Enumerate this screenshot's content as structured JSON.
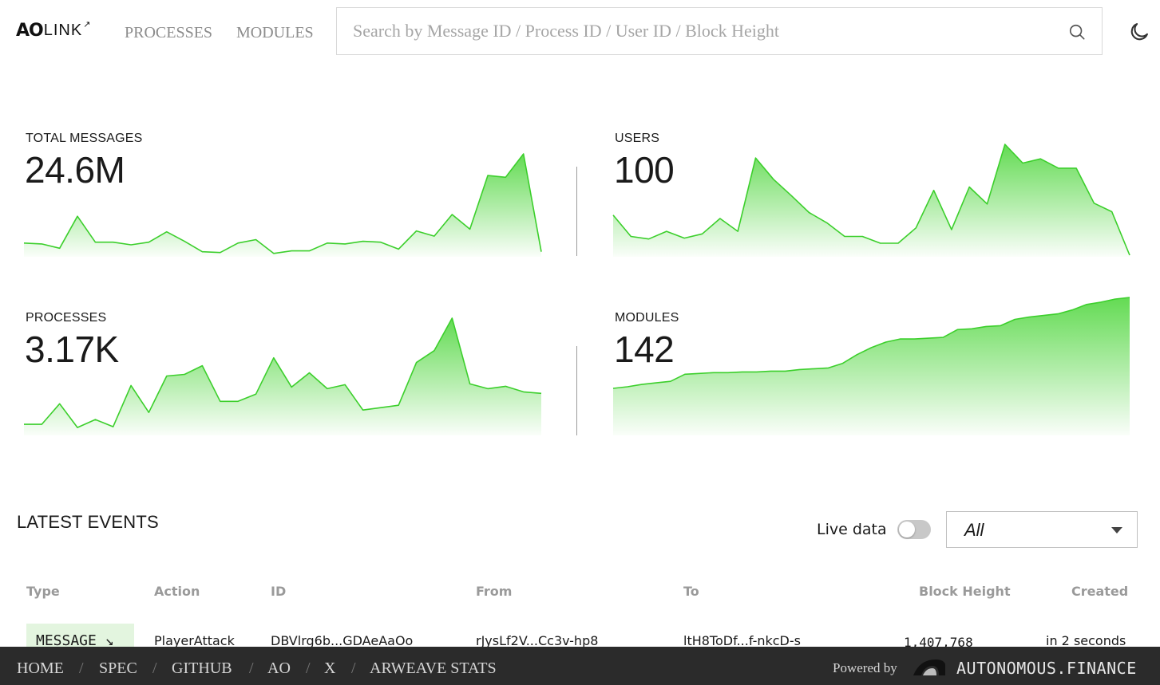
{
  "header": {
    "logo_ao": "AO",
    "logo_link": "LINK",
    "logo_arrow": "↗",
    "nav": [
      {
        "label": "PROCESSES"
      },
      {
        "label": "MODULES"
      }
    ],
    "search_placeholder": "Search by Message ID / Process ID / User ID / Block Height"
  },
  "stats": {
    "total_messages": {
      "label": "TOTAL MESSAGES",
      "value": "24.6M"
    },
    "users": {
      "label": "USERS",
      "value": "100"
    },
    "processes": {
      "label": "PROCESSES",
      "value": "3.17K"
    },
    "modules": {
      "label": "MODULES",
      "value": "142"
    }
  },
  "colors": {
    "accent": "#3ccf2c",
    "fill_top": "#5bd94a"
  },
  "chart_data": [
    {
      "type": "area",
      "name": "total_messages",
      "values": [
        14,
        13,
        8,
        45,
        15,
        15,
        12,
        15,
        27,
        16,
        4,
        3,
        14,
        18,
        2,
        5,
        5,
        14,
        13,
        16,
        15,
        7,
        28,
        22,
        47,
        30,
        92,
        90,
        117,
        4
      ]
    },
    {
      "type": "area",
      "name": "users",
      "values": [
        47,
        22,
        19,
        28,
        20,
        25,
        43,
        28,
        114,
        89,
        70,
        50,
        38,
        22,
        22,
        14,
        14,
        32,
        76,
        30,
        80,
        60,
        130,
        108,
        113,
        102,
        102,
        61,
        51,
        0
      ]
    },
    {
      "type": "area",
      "name": "processes",
      "values": [
        12,
        12,
        38,
        8,
        18,
        9,
        61,
        27,
        73,
        75,
        86,
        41,
        41,
        50,
        96,
        59,
        77,
        57,
        62,
        30,
        33,
        36,
        90,
        105,
        146,
        63,
        57,
        60,
        53,
        51
      ]
    },
    {
      "type": "area",
      "name": "modules",
      "values": [
        58,
        60,
        63,
        65,
        67,
        76,
        77,
        78,
        78,
        79,
        79,
        80,
        80,
        82,
        83,
        84,
        90,
        101,
        110,
        117,
        121,
        121,
        122,
        123,
        133,
        134,
        137,
        138,
        146,
        149,
        151,
        153,
        158,
        165,
        168,
        172,
        174
      ]
    }
  ],
  "events": {
    "title": "LATEST EVENTS",
    "live_label": "Live data",
    "filter_value": "All",
    "columns": [
      "Type",
      "Action",
      "ID",
      "From",
      "To",
      "Block Height",
      "Created"
    ],
    "rows": [
      {
        "type": "MESSAGE ↘",
        "action": "PlayerAttack",
        "id": "DBVlrg6b...GDAeAaOo",
        "from": "rJysLf2V...Cc3v-hp8",
        "to": "ltH8ToDf...f-nkcD-s",
        "block_height": "1,407,768",
        "created": "in 2 seconds"
      }
    ]
  },
  "footer": {
    "links": [
      {
        "label": "HOME"
      },
      {
        "label": "SPEC"
      },
      {
        "label": "GITHUB"
      },
      {
        "label": "AO"
      },
      {
        "label": "X"
      },
      {
        "label": "ARWEAVE STATS"
      }
    ],
    "separator": "/",
    "powered_by": "Powered by",
    "brand": "AUTONOMOUS.FINANCE"
  }
}
